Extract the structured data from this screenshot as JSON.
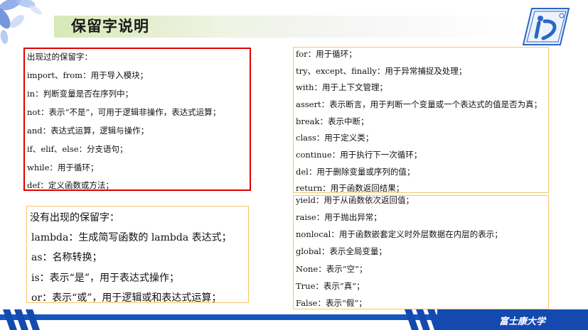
{
  "page": {
    "title": "保留字说明",
    "footer_text": "富士康大学"
  },
  "used_panel": {
    "heading": "出现过的保留字：",
    "items": [
      "import、from：用于导入模块；",
      "in：判断变量是否在序列中；",
      "not：表示“不是”，可用于逻辑非操作，表达式运算；",
      "and：表达式运算，逻辑与操作；",
      "if、elif、else：分支语句；",
      "while：用于循环；",
      "def：定义函数或方法；"
    ]
  },
  "unused_panel": {
    "heading": "没有出现的保留字：",
    "items": [
      "lambda：生成简写函数的 lambda 表达式；",
      "as：名称转换；",
      "is：表示“是”，用于表达式操作；",
      "or：表示“或”，用于逻辑或和表达式运算；"
    ]
  },
  "right_top_panel": {
    "items": [
      "for：用于循环；",
      "try、except、finally：用于异常捕捉及处理；",
      "with：用于上下文管理；",
      "assert：表示断言，用于判断一个变量或一个表达式的值是否为真；",
      "break：表示中断；",
      "class：用于定义类；",
      "continue：用于执行下一次循环；",
      "del：用于删除变量或序列的值；",
      "return：用于函数返回结果；"
    ]
  },
  "right_bottom_panel": {
    "items": [
      "yield：用于从函数依次返回值；",
      "raise：用于抛出异常；",
      "nonlocal：用于函数嵌套定义时外层数据在内层的表示；",
      "global：表示全局变量；",
      "None：表示“空”；",
      "True：表示“真”；",
      "False：表示“假”；"
    ]
  },
  "colors": {
    "accent_blue": "#1449b0",
    "red_border": "#e00000",
    "orange_border": "#f4c66a"
  },
  "icons": [
    "petal-decoration-icon",
    "university-logo-icon"
  ]
}
